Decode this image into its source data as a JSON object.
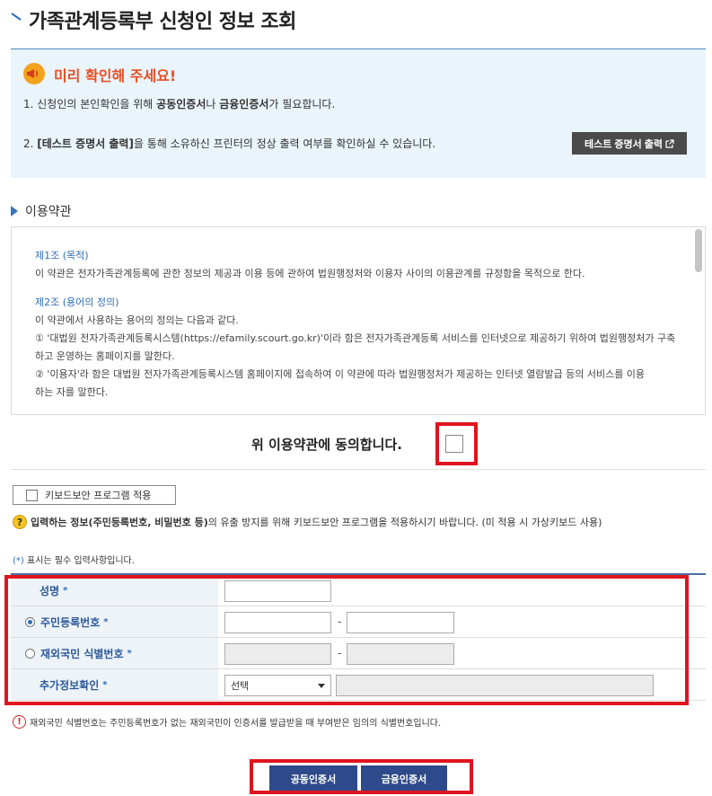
{
  "page": {
    "title": "가족관계등록부 신청인 정보 조회"
  },
  "notice": {
    "title": "미리 확인해 주세요!",
    "line1_prefix": "1. 신청인의 본인확인을 위해 ",
    "line1_bold1": "공동인증서",
    "line1_mid": "나 ",
    "line1_bold2": "금융인증서",
    "line1_suffix": "가 필요합니다.",
    "line2_prefix": "2. ",
    "line2_bold": "[테스트 증명서 출력]",
    "line2_suffix": "을 통해 소유하신 프린터의 정상 출력 여부를 확인하실 수 있습니다.",
    "test_button_label": "테스트 증명서 출력",
    "test_button_icon": "external-link-icon"
  },
  "terms": {
    "section_title": "이용약관",
    "articles": [
      {
        "heading": "제1조 (목적)",
        "lines": [
          "이 약관은 전자가족관계등록에 관한 정보의 제공과 이용 등에 관하여 법원행정처와 이용자 사이의 이용관계를 규정함을 목적으로 한다."
        ]
      },
      {
        "heading": "제2조 (용어의 정의)",
        "lines": [
          "이 약관에서 사용하는 용어의 정의는 다음과 같다.",
          "① '대법원 전자가족관계등록시스템(https://efamily.scourt.go.kr)'이라 함은 전자가족관계등록 서비스를 인터넷으로 제공하기 위하여 법원행정처가 구축",
          "하고 운영하는 홈페이지를 말한다.",
          "② '이용자'라 함은 대법원 전자가족관계등록시스템 홈페이지에 접속하여 이 약관에 따라 법원행정처가 제공하는 인터넷 열람발급 등의 서비스를 이용",
          "하는 자를 말한다."
        ]
      }
    ],
    "agree_label": "위 이용약관에 동의합니다."
  },
  "keyboard": {
    "button_label": "키보드보안 프로그램 적용",
    "info_bold": "입력하는 정보(주민등록번호, 비밀번호 등)",
    "info_suffix": "의 유출 방지를 위해 키보드보안 프로그램을 적용하시기 바랍니다. (미 적용 시 가상키보드 사용)"
  },
  "form": {
    "required_note_star": "(*)",
    "required_note_text": " 표시는 필수 입력사항입니다.",
    "rows": {
      "name_label": "성명",
      "rrn_label": "주민등록번호",
      "foreign_label": "재외국민 식별번호",
      "extra_label": "추가정보확인",
      "extra_select_value": "선택"
    },
    "required_star": "*",
    "dash": "-",
    "rrn_selected": true
  },
  "warning": {
    "text": "재외국민 식별번호는 주민등록번호가 없는 재외국민이 인증서를 발급받을 때 부여받은 임의의 식별번호입니다."
  },
  "cert_buttons": {
    "public_cert": "공동인증서",
    "financial_cert": "금융인증서"
  },
  "colors": {
    "highlight": "#e0141e",
    "accent": "#2d6db7",
    "button_dark": "#2f4a8a",
    "notice_title": "#e94e24"
  }
}
